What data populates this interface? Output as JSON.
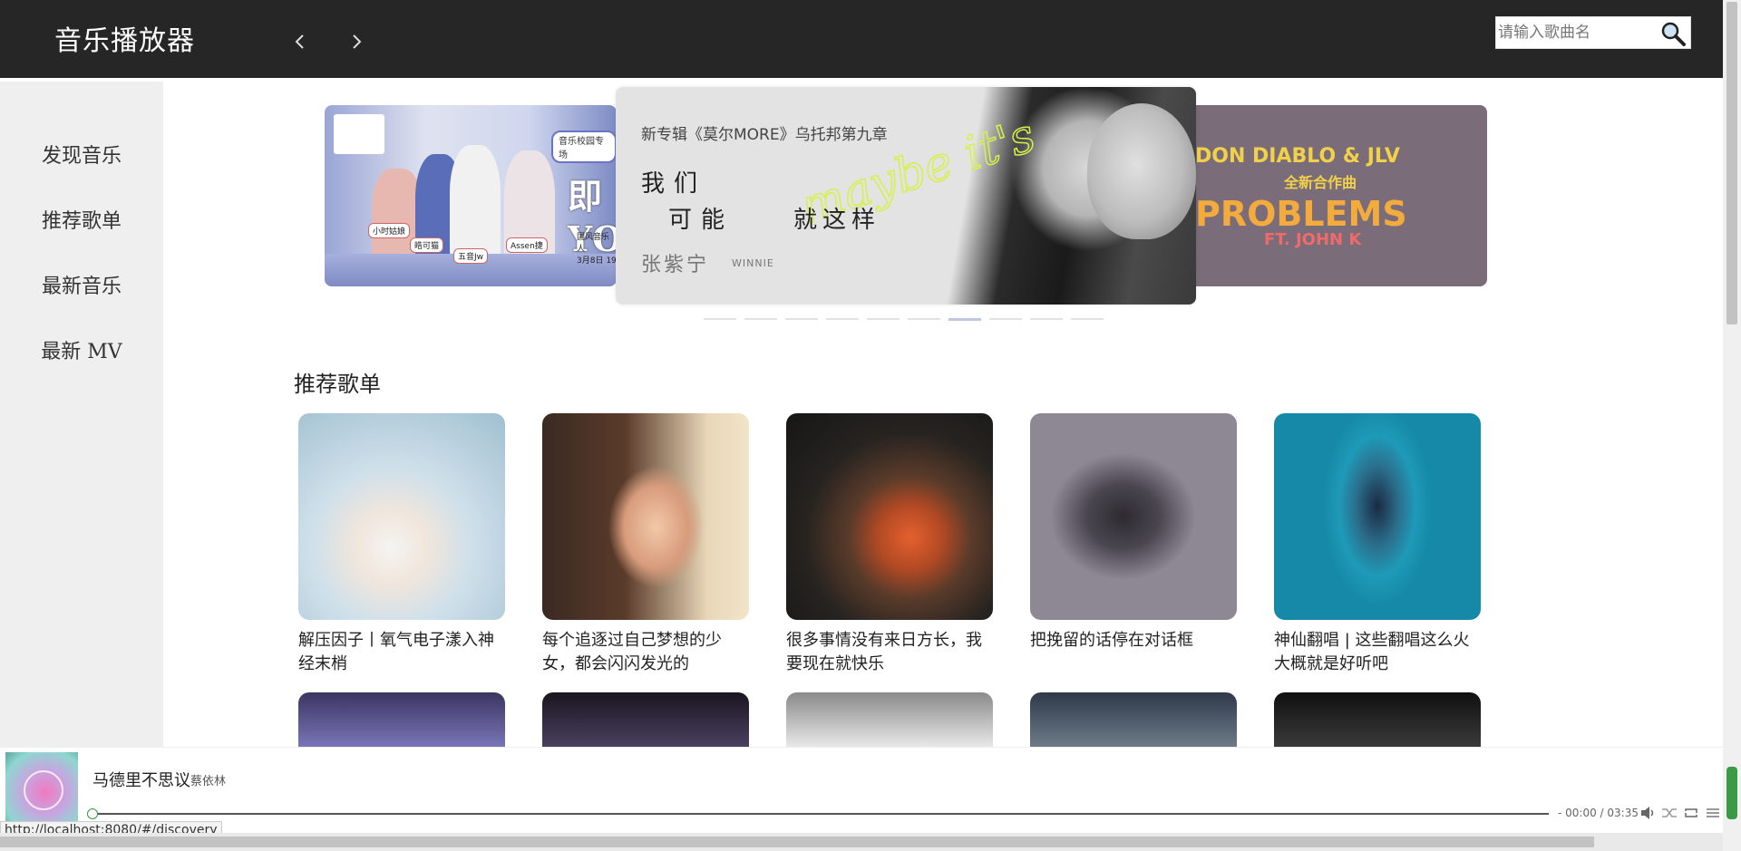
{
  "header": {
    "title": "音乐播放器",
    "search_placeholder": "请输入歌曲名"
  },
  "sidebar": {
    "items": [
      {
        "label": "发现音乐"
      },
      {
        "label": "推荐歌单"
      },
      {
        "label": "最新音乐"
      },
      {
        "label": "最新 MV"
      }
    ]
  },
  "banner": {
    "left": {
      "tag": "音乐校园专场",
      "big_text": "即 YOU",
      "names": [
        "小时姑娘",
        "皓可猫",
        "五音Jw",
        "Assen捷"
      ],
      "caption_line1": "国风音乐人",
      "caption_line2": "3月8日 19"
    },
    "center": {
      "title": "新专辑《莫尔MORE》乌托邦第九章",
      "lyric_line1": "我们",
      "lyric_line2": "可能",
      "lyric_line3": "就这样",
      "artist": "张紫宁",
      "artist_en": "WINNIE",
      "script_text": "maybe it's the end"
    },
    "right": {
      "line1": "DON DIABLO & JLV",
      "line2": "全新合作曲",
      "line3": "PROBLEMS",
      "line4": "FT. JOHN K"
    },
    "dot_count": 10,
    "active_dot": 6
  },
  "playlists": {
    "section_title": "推荐歌单",
    "items": [
      {
        "title": "解压因子丨氧气电子漾入神经末梢"
      },
      {
        "title": "每个追逐过自己梦想的少女，都会闪闪发光的"
      },
      {
        "title": "很多事情没有来日方长，我要现在就快乐"
      },
      {
        "title": "把挽留的话停在对话框"
      },
      {
        "title": "神仙翻唱 | 这些翻唱这么火大概就是好听吧"
      }
    ]
  },
  "player": {
    "song": "马德里不思议",
    "artist": "蔡依林",
    "time": "- 00:00 / 03:35",
    "progress": 0
  },
  "status_url": "http://localhost:8080/#/discovery",
  "colors": {
    "header_bg": "#262626",
    "sidebar_bg": "#efefef",
    "accent_green": "#3c9a47"
  }
}
